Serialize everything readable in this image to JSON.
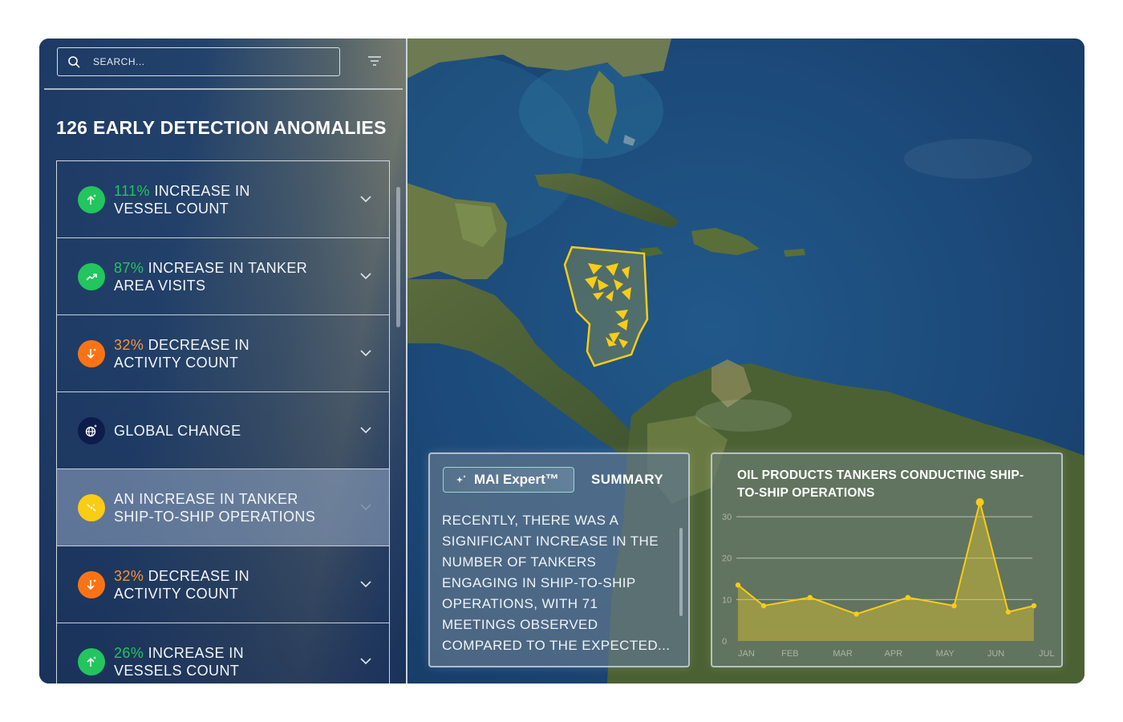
{
  "search": {
    "placeholder": "SEARCH..."
  },
  "panel": {
    "title": "126 EARLY DETECTION ANOMALIES",
    "items": [
      {
        "pct": "111%",
        "line1_rest": " INCREASE IN",
        "line2": "VESSEL COUNT",
        "tone": "green",
        "icon": "arrow-up-sparkle-icon"
      },
      {
        "pct": "87%",
        "line1_rest": " INCREASE IN TANKER",
        "line2": "AREA VISITS",
        "tone": "green",
        "icon": "trend-up-icon"
      },
      {
        "pct": "32%",
        "line1_rest": " DECREASE IN",
        "line2": "ACTIVITY COUNT",
        "tone": "orange",
        "icon": "arrow-down-sparkle-icon"
      },
      {
        "pct": "",
        "line1_rest": "GLOBAL CHANGE",
        "line2": "",
        "tone": "navy",
        "icon": "globe-sparkle-icon"
      },
      {
        "pct": "",
        "line1_rest": "AN INCREASE IN TANKER",
        "line2": "SHIP-TO-SHIP OPERATIONS",
        "tone": "yellow",
        "icon": "ship-transfer-icon"
      },
      {
        "pct": "32%",
        "line1_rest": " DECREASE IN",
        "line2": "ACTIVITY COUNT",
        "tone": "orange",
        "icon": "arrow-down-sparkle-icon"
      },
      {
        "pct": "26%",
        "line1_rest": " INCREASE IN",
        "line2": "VESSELS COUNT",
        "tone": "green",
        "icon": "arrow-up-sparkle-icon"
      }
    ],
    "selected_index": 4
  },
  "summary": {
    "expert_label": "MAI Expert™",
    "tab_label": "SUMMARY",
    "text": "RECENTLY, THERE WAS A SIGNIFICANT INCREASE IN THE NUMBER OF TANKERS ENGAGING IN SHIP-TO-SHIP OPERATIONS, WITH 71 MEETINGS OBSERVED COMPARED TO THE EXPECTED..."
  },
  "colors": {
    "accent_yellow": "#facc15",
    "green": "#22c55e",
    "orange": "#f97316",
    "navy": "#0d1c4a"
  },
  "chart_data": {
    "type": "area",
    "title": "OIL PRODUCTS TANKERS CONDUCTING SHIP-TO-SHIP OPERATIONS",
    "x": [
      0,
      0.5,
      1,
      1.5,
      2,
      2.5,
      3,
      3.5,
      4,
      4.5,
      5,
      5.5,
      6
    ],
    "y": [
      13.5,
      8.5,
      10.5,
      6.5,
      10.5,
      8.5,
      33.5,
      7,
      8.5
    ],
    "points": [
      {
        "x": 0.0,
        "y": 13.5
      },
      {
        "x": 0.5,
        "y": 8.5
      },
      {
        "x": 1.4,
        "y": 10.5
      },
      {
        "x": 2.3,
        "y": 6.5
      },
      {
        "x": 3.3,
        "y": 10.5
      },
      {
        "x": 4.2,
        "y": 8.5
      },
      {
        "x": 4.7,
        "y": 33.5
      },
      {
        "x": 5.25,
        "y": 7.0
      },
      {
        "x": 5.75,
        "y": 8.5
      }
    ],
    "x_tick_labels": [
      "JAN",
      "FEB",
      "MAR",
      "APR",
      "MAY",
      "JUN",
      "JUL"
    ],
    "y_ticks": [
      0,
      10,
      20,
      30
    ],
    "ylim": [
      0,
      33.5
    ],
    "grid": true,
    "line_color": "#facc15"
  }
}
